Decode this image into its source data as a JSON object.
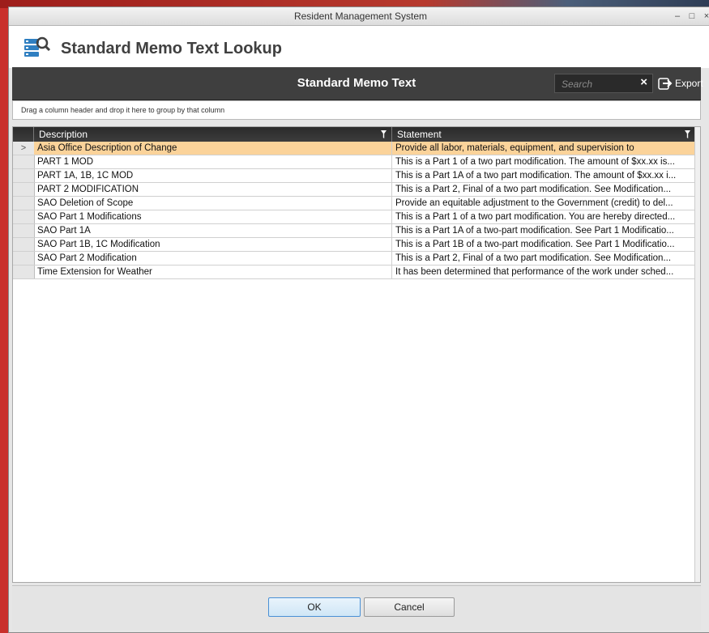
{
  "window": {
    "title": "Resident Management System",
    "minimize": "–",
    "maximize": "□",
    "close": "×"
  },
  "header": {
    "title": "Standard Memo Text Lookup",
    "icon": "database-search-icon"
  },
  "grid_toolbar": {
    "title": "Standard Memo Text",
    "search_placeholder": "Search",
    "clear_icon": "×",
    "export_label": "Export"
  },
  "group_panel": {
    "hint": "Drag a column header and drop it here to group by that column"
  },
  "grid": {
    "columns": [
      "Description",
      "Statement"
    ],
    "selected_indicator": ">",
    "rows": [
      {
        "description": "Asia Office Description of Change",
        "statement": "Provide all labor, materials, equipment, and supervision to"
      },
      {
        "description": "PART 1 MOD",
        "statement": "This is a Part 1 of a two part modification.  The amount of $xx.xx is..."
      },
      {
        "description": "PART 1A, 1B, 1C MOD",
        "statement": "This is a Part 1A of a two part modification.  The amount of $xx.xx i..."
      },
      {
        "description": "PART 2 MODIFICATION",
        "statement": "This is a Part 2, Final of a two part modification.  See Modification..."
      },
      {
        "description": "SAO Deletion of Scope",
        "statement": "Provide an equitable adjustment to the Government (credit) to del..."
      },
      {
        "description": "SAO Part 1 Modifications",
        "statement": "This is a Part 1 of a two part modification.  You are hereby directed..."
      },
      {
        "description": "SAO Part 1A",
        "statement": "This is a Part 1A of a two-part modification.  See Part 1 Modificatio..."
      },
      {
        "description": "SAO Part 1B, 1C Modification",
        "statement": "This is a Part 1B of a two-part modification.  See Part 1 Modificatio..."
      },
      {
        "description": "SAO Part 2 Modification",
        "statement": "This is a Part 2, Final of a two part modification.  See Modification..."
      },
      {
        "description": "Time Extension for Weather",
        "statement": "It has been determined that performance of the work under sched..."
      }
    ]
  },
  "footer": {
    "ok_label": "OK",
    "cancel_label": "Cancel"
  },
  "colors": {
    "toolbar_bg": "#3f3f3f",
    "selected_row": "#fbd39a",
    "ok_border": "#4a90d6"
  }
}
